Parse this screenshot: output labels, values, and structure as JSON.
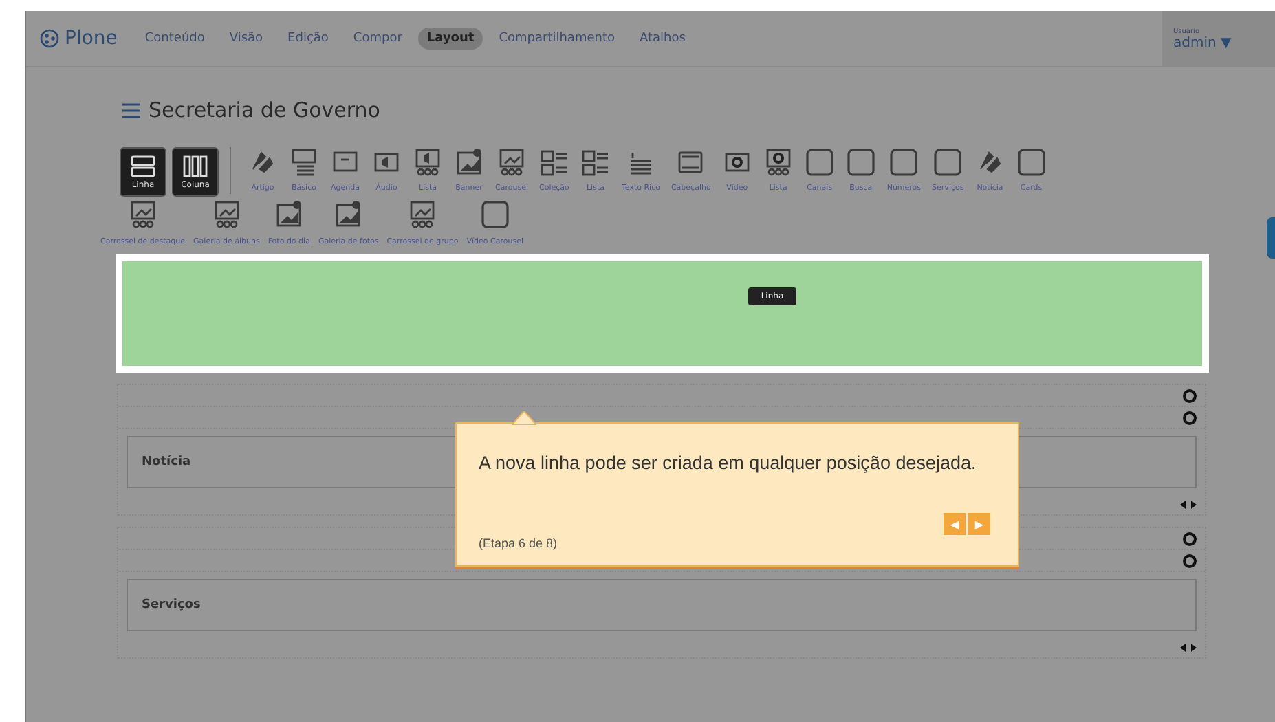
{
  "topbar": {
    "logo": "Plone",
    "nav": [
      {
        "label": "Conteúdo",
        "selected": false
      },
      {
        "label": "Visão",
        "selected": false
      },
      {
        "label": "Edição",
        "selected": false
      },
      {
        "label": "Compor",
        "selected": false
      },
      {
        "label": "Layout",
        "selected": true
      },
      {
        "label": "Compartilhamento",
        "selected": false
      },
      {
        "label": "Atalhos",
        "selected": false
      }
    ],
    "user_caption": "Usuário",
    "user": "admin ▼"
  },
  "page_title": "Secretaria de Governo",
  "toolbar": {
    "layout_buttons": [
      {
        "label": "Linha",
        "kind": "rows"
      },
      {
        "label": "Coluna",
        "kind": "columns"
      }
    ],
    "tiles": [
      {
        "label": "Artigo",
        "kind": "feather"
      },
      {
        "label": "Básico",
        "kind": "image-lines"
      },
      {
        "label": "Agenda",
        "kind": "calendar"
      },
      {
        "label": "Áudio",
        "kind": "audio"
      },
      {
        "label": "Lista",
        "kind": "audio-list"
      },
      {
        "label": "Banner",
        "kind": "banner"
      },
      {
        "label": "Carousel",
        "kind": "image-list"
      },
      {
        "label": "Coleção",
        "kind": "two-images"
      },
      {
        "label": "Lista",
        "kind": "two-images"
      },
      {
        "label": "Texto Rico",
        "kind": "text"
      },
      {
        "label": "Cabeçalho",
        "kind": "header"
      },
      {
        "label": "Vídeo",
        "kind": "video"
      },
      {
        "label": "Lista",
        "kind": "video-list"
      },
      {
        "label": "Canais",
        "kind": "blank"
      },
      {
        "label": "Busca",
        "kind": "blank"
      },
      {
        "label": "Números",
        "kind": "blank"
      },
      {
        "label": "Serviços",
        "kind": "blank"
      },
      {
        "label": "Notícia",
        "kind": "feather"
      },
      {
        "label": "Cards",
        "kind": "blank"
      }
    ],
    "tiles_row2": [
      {
        "label": "Carrossel de destaque",
        "kind": "image-list"
      },
      {
        "label": "Galeria de álbuns",
        "kind": "image-list"
      },
      {
        "label": "Foto do dia",
        "kind": "banner"
      },
      {
        "label": "Galeria de fotos",
        "kind": "banner"
      },
      {
        "label": "Carrossel de grupo",
        "kind": "image-list"
      },
      {
        "label": "Vídeo Carousel",
        "kind": "blank"
      }
    ]
  },
  "new_row": {
    "label": "Linha"
  },
  "sections": [
    {
      "tile": "Notícia"
    },
    {
      "tile": "Serviços"
    }
  ],
  "tooltip": {
    "message": "A nova linha pode ser criada em qualquer posição desejada.",
    "step": "(Etapa 6 de 8)",
    "prev": "◀",
    "next": "▶"
  }
}
